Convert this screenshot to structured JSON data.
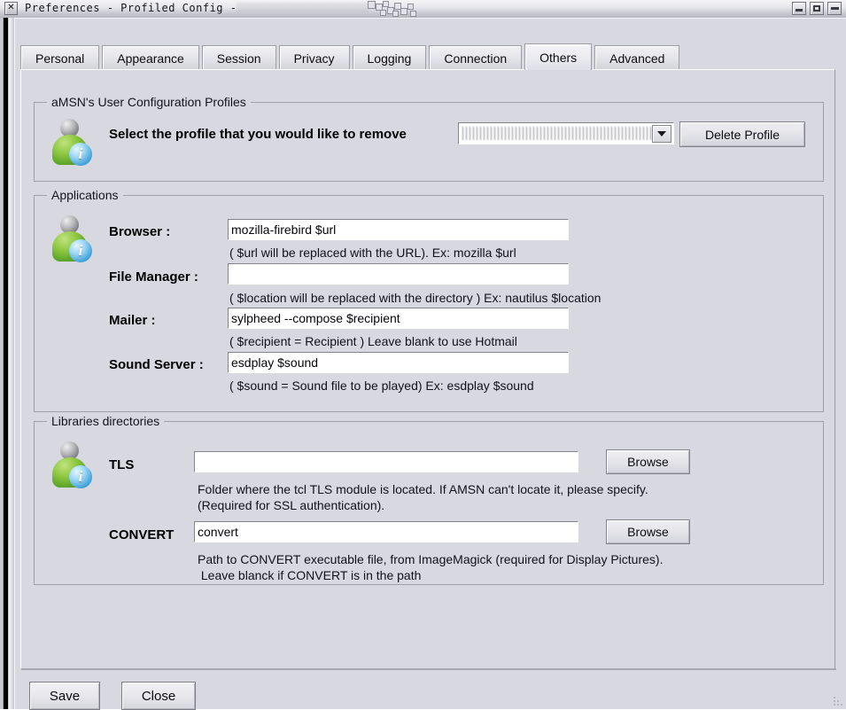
{
  "window": {
    "title": "Preferences - Profiled Config -",
    "title_redacted": true,
    "system_menu_glyph": "✕",
    "controls": [
      {
        "name": "minimize",
        "glyph": "_"
      },
      {
        "name": "maximize",
        "glyph": "□"
      },
      {
        "name": "close",
        "glyph": "–"
      }
    ]
  },
  "tabs": [
    {
      "label": "Personal",
      "active": false
    },
    {
      "label": "Appearance",
      "active": false
    },
    {
      "label": "Session",
      "active": false
    },
    {
      "label": "Privacy",
      "active": false
    },
    {
      "label": "Logging",
      "active": false
    },
    {
      "label": "Connection",
      "active": false
    },
    {
      "label": "Others",
      "active": true
    },
    {
      "label": "Advanced",
      "active": false
    }
  ],
  "profiles": {
    "group_title": "aMSN's User Configuration Profiles",
    "label": "Select the profile that you would like to remove",
    "combo_value": "",
    "combo_redacted": true,
    "delete_button": "Delete Profile"
  },
  "applications": {
    "group_title": "Applications",
    "rows": [
      {
        "label": "Browser :",
        "value": "mozilla-firebird $url",
        "hint": "( $url will be replaced with the URL). Ex: mozilla $url"
      },
      {
        "label": "File Manager :",
        "value": "",
        "hint": "( $location will be replaced with the directory ) Ex: nautilus $location"
      },
      {
        "label": "Mailer :",
        "value": "sylpheed --compose $recipient",
        "hint": "( $recipient = Recipient ) Leave blank to use Hotmail"
      },
      {
        "label": "Sound Server :",
        "value": "esdplay $sound",
        "hint": "( $sound = Sound file to be played) Ex: esdplay $sound"
      }
    ]
  },
  "libraries": {
    "group_title": "Libraries directories",
    "rows": [
      {
        "label": "TLS",
        "value": "",
        "browse_label": "Browse",
        "hint": "Folder where the tcl TLS module is located. If AMSN can't locate it, please specify.\n(Required for SSL authentication)."
      },
      {
        "label": "CONVERT",
        "value": "convert",
        "browse_label": "Browse",
        "hint": "Path to CONVERT executable file, from ImageMagick (required for Display Pictures).\n Leave blanck if CONVERT is in the path"
      }
    ]
  },
  "footer": {
    "save_label": "Save",
    "close_label": "Close"
  },
  "icons": {
    "buddy_info_glyph": "i"
  },
  "colors": {
    "window_bg": "#d8d8e0",
    "titlebar": "#e7e7ec",
    "field_bg": "#ffffff",
    "border": "#9fa0aa",
    "text": "#000000"
  }
}
